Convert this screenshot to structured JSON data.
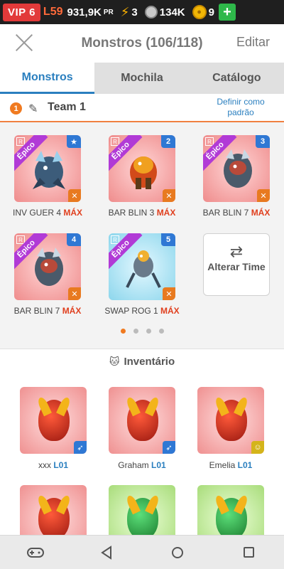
{
  "status": {
    "vip": "VIP 6",
    "level": "L59",
    "power": "931,9K",
    "power_unit": "PR",
    "energy": "3",
    "food": "134K",
    "gold": "9",
    "add": "+"
  },
  "header": {
    "title": "Monstros (106/118)",
    "edit": "Editar"
  },
  "tabs": [
    {
      "label": "Monstros",
      "active": true
    },
    {
      "label": "Mochila",
      "active": false
    },
    {
      "label": "Catálogo",
      "active": false
    }
  ],
  "team": {
    "number": "1",
    "name": "Team 1",
    "set_default": "Definir como padrão"
  },
  "team_monsters": [
    {
      "rarity": "Épico",
      "badge": "★",
      "name": "INV GUER 4",
      "max": "MÁX",
      "color": "pink"
    },
    {
      "rarity": "Épico",
      "badge": "2",
      "name": "BAR BLIN 3",
      "max": "MÁX",
      "color": "pink"
    },
    {
      "rarity": "Épico",
      "badge": "3",
      "name": "BAR BLIN 7",
      "max": "MÁX",
      "color": "pink"
    },
    {
      "rarity": "Épico",
      "badge": "4",
      "name": "BAR BLIN 7",
      "max": "MÁX",
      "color": "pink"
    },
    {
      "rarity": "Épico",
      "badge": "5",
      "name": "SWAP ROG 1",
      "max": "MÁX",
      "color": "cyan"
    }
  ],
  "swap_team": "Alterar Time",
  "inventory": {
    "title": "Inventário",
    "items": [
      {
        "name": "xxx",
        "level": "L01",
        "color": "pink",
        "element": "blue"
      },
      {
        "name": "Graham",
        "level": "L01",
        "color": "pink",
        "element": "blue"
      },
      {
        "name": "Emelia",
        "level": "L01",
        "color": "pink",
        "element": "yellow"
      },
      {
        "name": "",
        "level": "",
        "color": "pink",
        "element": ""
      },
      {
        "name": "",
        "level": "",
        "color": "green",
        "element": ""
      },
      {
        "name": "",
        "level": "",
        "color": "green",
        "element": ""
      }
    ]
  },
  "colors": {
    "accent": "#2a7fbf",
    "orange": "#f07a20",
    "vip": "#e23a3a",
    "max": "#e0401f"
  }
}
